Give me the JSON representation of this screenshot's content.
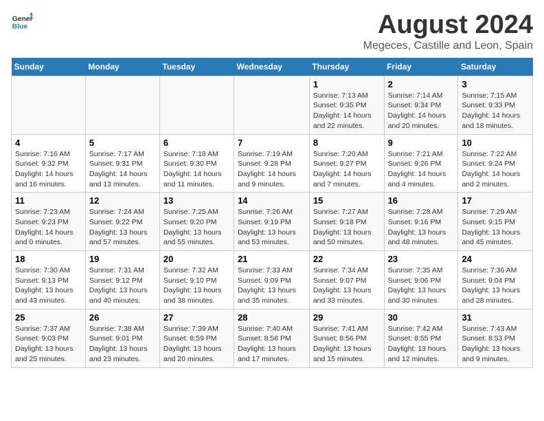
{
  "header": {
    "logo_general": "General",
    "logo_blue": "Blue",
    "title": "August 2024",
    "subtitle": "Megeces, Castille and Leon, Spain"
  },
  "weekdays": [
    "Sunday",
    "Monday",
    "Tuesday",
    "Wednesday",
    "Thursday",
    "Friday",
    "Saturday"
  ],
  "weeks": [
    [
      {
        "day": "",
        "info": ""
      },
      {
        "day": "",
        "info": ""
      },
      {
        "day": "",
        "info": ""
      },
      {
        "day": "",
        "info": ""
      },
      {
        "day": "1",
        "info": "Sunrise: 7:13 AM\nSunset: 9:35 PM\nDaylight: 14 hours\nand 22 minutes."
      },
      {
        "day": "2",
        "info": "Sunrise: 7:14 AM\nSunset: 9:34 PM\nDaylight: 14 hours\nand 20 minutes."
      },
      {
        "day": "3",
        "info": "Sunrise: 7:15 AM\nSunset: 9:33 PM\nDaylight: 14 hours\nand 18 minutes."
      }
    ],
    [
      {
        "day": "4",
        "info": "Sunrise: 7:16 AM\nSunset: 9:32 PM\nDaylight: 14 hours\nand 16 minutes."
      },
      {
        "day": "5",
        "info": "Sunrise: 7:17 AM\nSunset: 9:31 PM\nDaylight: 14 hours\nand 13 minutes."
      },
      {
        "day": "6",
        "info": "Sunrise: 7:18 AM\nSunset: 9:30 PM\nDaylight: 14 hours\nand 11 minutes."
      },
      {
        "day": "7",
        "info": "Sunrise: 7:19 AM\nSunset: 9:28 PM\nDaylight: 14 hours\nand 9 minutes."
      },
      {
        "day": "8",
        "info": "Sunrise: 7:20 AM\nSunset: 9:27 PM\nDaylight: 14 hours\nand 7 minutes."
      },
      {
        "day": "9",
        "info": "Sunrise: 7:21 AM\nSunset: 9:26 PM\nDaylight: 14 hours\nand 4 minutes."
      },
      {
        "day": "10",
        "info": "Sunrise: 7:22 AM\nSunset: 9:24 PM\nDaylight: 14 hours\nand 2 minutes."
      }
    ],
    [
      {
        "day": "11",
        "info": "Sunrise: 7:23 AM\nSunset: 9:23 PM\nDaylight: 14 hours\nand 0 minutes."
      },
      {
        "day": "12",
        "info": "Sunrise: 7:24 AM\nSunset: 9:22 PM\nDaylight: 13 hours\nand 57 minutes."
      },
      {
        "day": "13",
        "info": "Sunrise: 7:25 AM\nSunset: 9:20 PM\nDaylight: 13 hours\nand 55 minutes."
      },
      {
        "day": "14",
        "info": "Sunrise: 7:26 AM\nSunset: 9:19 PM\nDaylight: 13 hours\nand 53 minutes."
      },
      {
        "day": "15",
        "info": "Sunrise: 7:27 AM\nSunset: 9:18 PM\nDaylight: 13 hours\nand 50 minutes."
      },
      {
        "day": "16",
        "info": "Sunrise: 7:28 AM\nSunset: 9:16 PM\nDaylight: 13 hours\nand 48 minutes."
      },
      {
        "day": "17",
        "info": "Sunrise: 7:29 AM\nSunset: 9:15 PM\nDaylight: 13 hours\nand 45 minutes."
      }
    ],
    [
      {
        "day": "18",
        "info": "Sunrise: 7:30 AM\nSunset: 9:13 PM\nDaylight: 13 hours\nand 43 minutes."
      },
      {
        "day": "19",
        "info": "Sunrise: 7:31 AM\nSunset: 9:12 PM\nDaylight: 13 hours\nand 40 minutes."
      },
      {
        "day": "20",
        "info": "Sunrise: 7:32 AM\nSunset: 9:10 PM\nDaylight: 13 hours\nand 38 minutes."
      },
      {
        "day": "21",
        "info": "Sunrise: 7:33 AM\nSunset: 9:09 PM\nDaylight: 13 hours\nand 35 minutes."
      },
      {
        "day": "22",
        "info": "Sunrise: 7:34 AM\nSunset: 9:07 PM\nDaylight: 13 hours\nand 33 minutes."
      },
      {
        "day": "23",
        "info": "Sunrise: 7:35 AM\nSunset: 9:06 PM\nDaylight: 13 hours\nand 30 minutes."
      },
      {
        "day": "24",
        "info": "Sunrise: 7:36 AM\nSunset: 9:04 PM\nDaylight: 13 hours\nand 28 minutes."
      }
    ],
    [
      {
        "day": "25",
        "info": "Sunrise: 7:37 AM\nSunset: 9:03 PM\nDaylight: 13 hours\nand 25 minutes."
      },
      {
        "day": "26",
        "info": "Sunrise: 7:38 AM\nSunset: 9:01 PM\nDaylight: 13 hours\nand 23 minutes."
      },
      {
        "day": "27",
        "info": "Sunrise: 7:39 AM\nSunset: 8:59 PM\nDaylight: 13 hours\nand 20 minutes."
      },
      {
        "day": "28",
        "info": "Sunrise: 7:40 AM\nSunset: 8:58 PM\nDaylight: 13 hours\nand 17 minutes."
      },
      {
        "day": "29",
        "info": "Sunrise: 7:41 AM\nSunset: 8:56 PM\nDaylight: 13 hours\nand 15 minutes."
      },
      {
        "day": "30",
        "info": "Sunrise: 7:42 AM\nSunset: 8:55 PM\nDaylight: 13 hours\nand 12 minutes."
      },
      {
        "day": "31",
        "info": "Sunrise: 7:43 AM\nSunset: 8:53 PM\nDaylight: 13 hours\nand 9 minutes."
      }
    ]
  ]
}
